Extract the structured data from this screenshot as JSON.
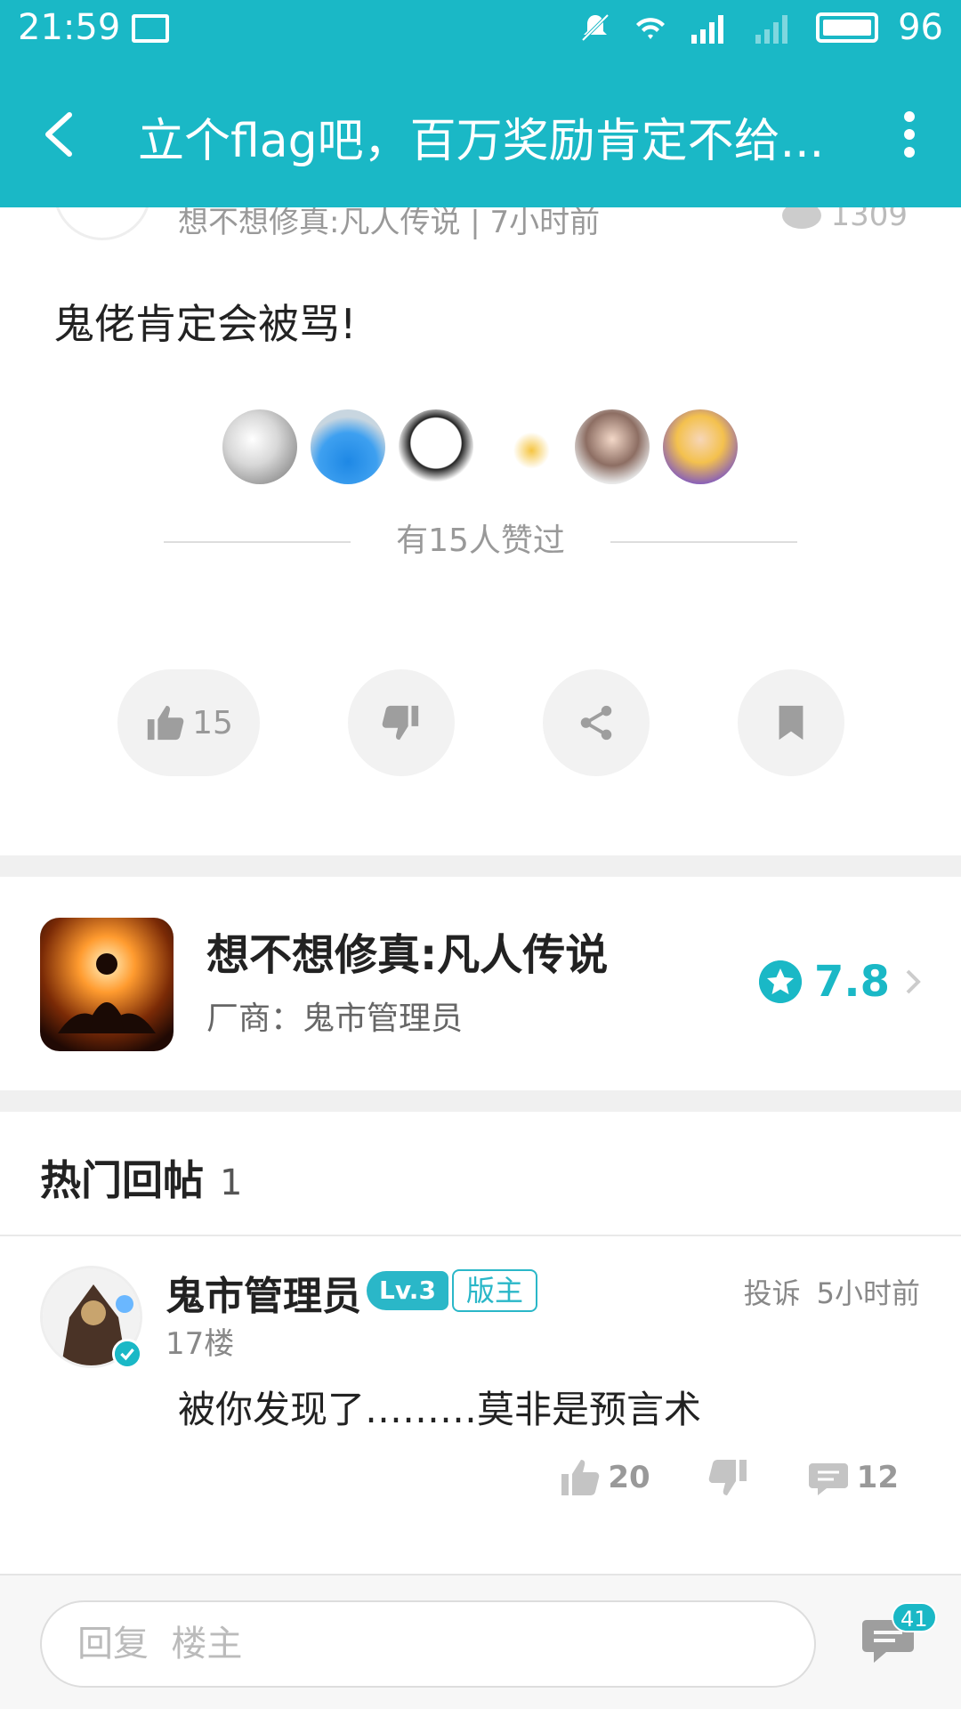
{
  "status_bar": {
    "time": "21:59",
    "battery": "96"
  },
  "toolbar": {
    "title": "立个flag吧，百万奖励肯定不给..."
  },
  "post": {
    "meta": "想不想修真:凡人传说 | 7小时前",
    "views": "1309",
    "body": "鬼佬肯定会被骂!",
    "liked_text": "有15人赞过",
    "actions": {
      "like_count": "15"
    }
  },
  "game": {
    "name": "想不想修真:凡人传说",
    "vendor": "厂商：鬼市管理员",
    "rating": "7.8"
  },
  "hot": {
    "title": "热门回帖",
    "count": "1"
  },
  "reply": {
    "name": "鬼市管理员",
    "level": "Lv.3",
    "role": "版主",
    "floor": "17楼",
    "report": "投诉",
    "time": "5小时前",
    "text": "被你发现了………莫非是预言术",
    "likes": "20",
    "comments": "12"
  },
  "bottom": {
    "placeholder": "回复  楼主",
    "badge": "41"
  },
  "colors": {
    "accent": "#1ab8c6"
  }
}
